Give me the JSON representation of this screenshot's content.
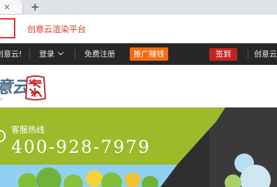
{
  "browser": {
    "tab_close_glyph": "×",
    "new_tab_glyph": "+"
  },
  "annotation": {
    "caption": "创意云渲染平台"
  },
  "nav": {
    "site_name": "创意云!",
    "login": "登录",
    "register": "免费注册",
    "promo_button": "推广赚钱",
    "checkin_button": "签到",
    "right_link": "创意云首"
  },
  "logo": {
    "text": "意云",
    "seal_chars": "渲染"
  },
  "hero": {
    "service_label": "客服热线",
    "phone": "400-928-7979"
  },
  "colors": {
    "accent_red": "#e3302b",
    "nav_bg": "#272727",
    "promo_orange": "#f66b10",
    "checkin_red": "#c42323",
    "hero_green": "#9cba2a"
  },
  "icons": [
    "close-icon",
    "plus-icon",
    "chevron-down-icon",
    "headset-icon",
    "seal-logo"
  ]
}
